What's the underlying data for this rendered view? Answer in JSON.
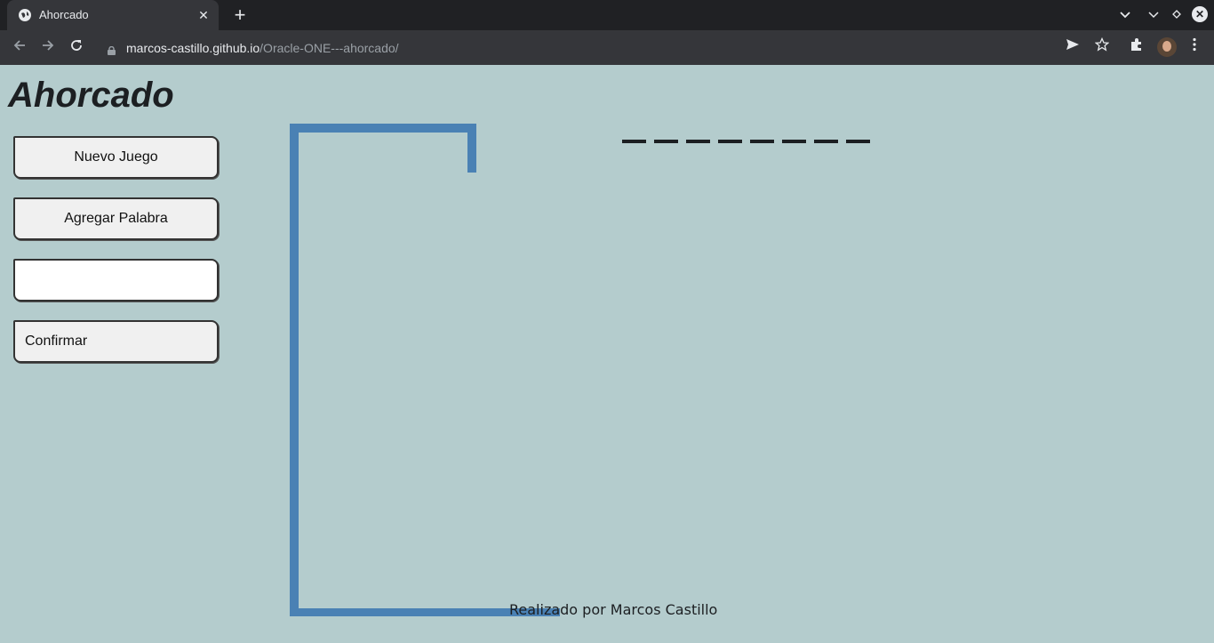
{
  "browser": {
    "tab_title": "Ahorcado",
    "tab_close": "✕",
    "new_tab": "+",
    "url_host": "marcos-castillo.github.io",
    "url_path": "/Oracle-ONE---ahorcado/",
    "icons": [
      "back-icon",
      "forward-icon",
      "reload-icon",
      "lock-icon",
      "send-icon",
      "star-icon",
      "extensions-icon",
      "avatar",
      "menu-icon"
    ]
  },
  "page": {
    "title": "Ahorcado",
    "buttons": {
      "new_game": "Nuevo Juego",
      "add_word": "Agregar Palabra",
      "confirm": "Confirmar"
    },
    "word_input": {
      "value": "",
      "placeholder": ""
    },
    "hidden_word_length": 8,
    "footer": "Realizado por Marcos Castillo"
  },
  "colors": {
    "background": "#b4cccd",
    "gallows": "#4a81b4",
    "dash": "#1c1f22"
  }
}
